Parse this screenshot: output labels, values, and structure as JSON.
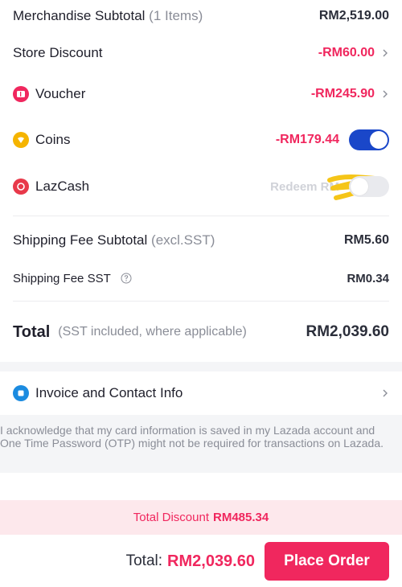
{
  "summary": {
    "merch_label": "Merchandise Subtotal",
    "merch_items": "(1 Items)",
    "merch_value": "RM2,519.00",
    "store_discount_label": "Store Discount",
    "store_discount_value": "-RM60.00",
    "voucher_label": "Voucher",
    "voucher_value": "-RM245.90",
    "coins_label": "Coins",
    "coins_value": "-RM179.44",
    "coins_toggle_on": true,
    "lazcash_label": "LazCash",
    "lazcash_redeem_text": "Redeem RM",
    "lazcash_toggle_on": false,
    "shipping_label": "Shipping Fee Subtotal",
    "shipping_note": "(excl.SST)",
    "shipping_value": "RM5.60",
    "shipping_sst_label": "Shipping Fee SST",
    "shipping_sst_value": "RM0.34",
    "total_label": "Total",
    "total_note": "(SST included, where applicable)",
    "total_value": "RM2,039.60"
  },
  "invoice": {
    "label": "Invoice and Contact Info"
  },
  "acknowledgement": "I acknowledge that my card information is saved in my Lazada account and One Time Password (OTP) might not be required for transactions on Lazada.",
  "footer": {
    "discount_label": "Total Discount",
    "discount_value": "RM485.34",
    "total_label": "Total:",
    "total_value": "RM2,039.60",
    "place_order": "Place Order"
  },
  "colors": {
    "brand_pink": "#f0275e",
    "toggle_blue": "#1a47c9",
    "coin_yellow": "#f5b400",
    "scribble": "#f5c518"
  }
}
